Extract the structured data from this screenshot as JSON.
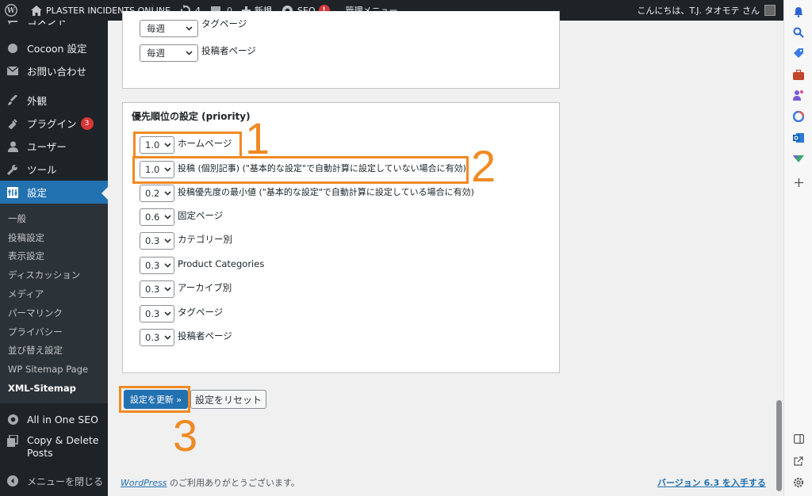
{
  "adminbar": {
    "site_name": "PLASTER INCIDENTS ONLINE",
    "updates_count": "4",
    "comments_count": "0",
    "new_label": "新規",
    "seo_label": "SEO",
    "seo_badge": "!",
    "admin_menu_label": "管理メニュー",
    "greeting": "こんにちは、T.J. タオモテ さん"
  },
  "sidebar": {
    "items": [
      {
        "label": "コメント",
        "icon": "comment-icon"
      },
      {
        "label": "Cocoon 設定",
        "icon": "circle-icon"
      },
      {
        "label": "お問い合わせ",
        "icon": "mail-icon"
      },
      {
        "label": "外観",
        "icon": "paintbrush-icon"
      },
      {
        "label": "プラグイン",
        "icon": "plugin-icon",
        "badge": "3"
      },
      {
        "label": "ユーザー",
        "icon": "user-icon"
      },
      {
        "label": "ツール",
        "icon": "wrench-icon"
      },
      {
        "label": "設定",
        "icon": "settings-icon"
      }
    ],
    "submenu": [
      "一般",
      "投稿設定",
      "表示設定",
      "ディスカッション",
      "メディア",
      "パーマリンク",
      "プライバシー",
      "並び替え設定",
      "WP Sitemap Page",
      "XML-Sitemap"
    ],
    "after": [
      {
        "label": "All in One SEO",
        "icon": "seo-gear-icon"
      },
      {
        "label": "Copy & Delete Posts",
        "icon": "copy-icon"
      }
    ],
    "collapse_label": "メニューを閉じる"
  },
  "frequency_box": {
    "rows": [
      {
        "value": "毎週",
        "label": "タグページ"
      },
      {
        "value": "毎週",
        "label": "投稿者ページ"
      }
    ]
  },
  "priority_box": {
    "title": "優先順位の設定 (priority)",
    "rows": [
      {
        "value": "1.0",
        "label": "ホームページ"
      },
      {
        "value": "1.0",
        "label": "投稿 (個別記事) (\"基本的な設定\"で自動計算に設定していない場合に有効)"
      },
      {
        "value": "0.2",
        "label": "投稿優先度の最小値 (\"基本的な設定\"で自動計算に設定している場合に有効)"
      },
      {
        "value": "0.6",
        "label": "固定ページ"
      },
      {
        "value": "0.3",
        "label": "カテゴリー別"
      },
      {
        "value": "0.3",
        "label": "Product Categories"
      },
      {
        "value": "0.3",
        "label": "アーカイブ別"
      },
      {
        "value": "0.3",
        "label": "タグページ"
      },
      {
        "value": "0.3",
        "label": "投稿者ページ"
      }
    ]
  },
  "buttons": {
    "update": "設定を更新 »",
    "reset": "設定をリセット"
  },
  "annotations": [
    "1",
    "2",
    "3"
  ],
  "footer": {
    "wordpress_link": "WordPress",
    "thanks": " のご利用ありがとうございます。",
    "version_link": "バージョン 6.3 を入手する"
  },
  "colors": {
    "accent": "#2271b1",
    "annotation": "#f08a24",
    "adminbar": "#1d2327"
  }
}
